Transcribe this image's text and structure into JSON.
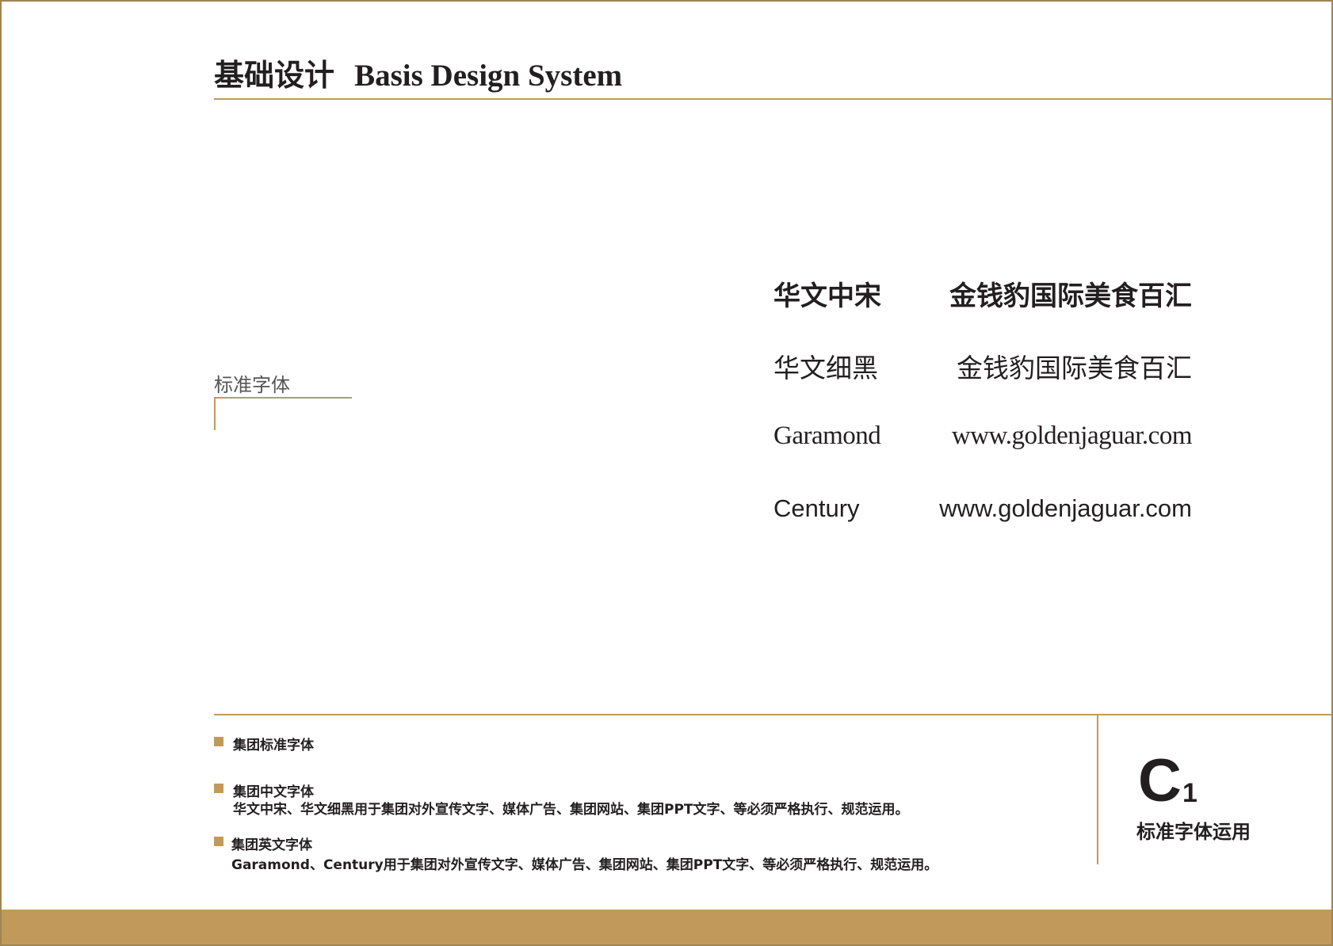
{
  "header": {
    "title_cn": "基础设计",
    "title_en": "Basis Design System"
  },
  "section": {
    "title": "标准字体"
  },
  "font_samples": [
    {
      "font_name": "华文中宋",
      "sample": "金钱豹国际美食百汇"
    },
    {
      "font_name": "华文细黑",
      "sample": "金钱豹国际美食百汇"
    },
    {
      "font_name": "Garamond",
      "sample": "www.goldenjaguar.com"
    },
    {
      "font_name": "Century",
      "sample": "www.goldenjaguar.com"
    }
  ],
  "notes": [
    {
      "title": "集团标准字体",
      "desc": ""
    },
    {
      "title": "集团中文字体",
      "desc": "华文中宋、华文细黑用于集团对外宣传文字、媒体广告、集团网站、集团PPT文字、等必须严格执行、规范运用。"
    },
    {
      "title": "集团英文字体",
      "desc": "Garamond、Century用于集团对外宣传文字、媒体广告、集团网站、集团PPT文字、等必须严格执行、规范运用。"
    }
  ],
  "page_code": {
    "letter": "C",
    "number": "1",
    "label": "标准字体运用"
  },
  "colors": {
    "accent": "#c19a5b",
    "border": "#a08552",
    "text": "#231f20"
  }
}
